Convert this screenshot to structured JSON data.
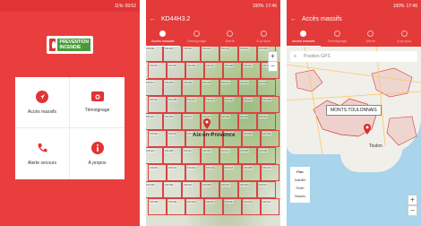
{
  "phone1": {
    "status_time": "09:52",
    "status_battery": "11%",
    "logo_line1": "PREVENTION",
    "logo_line2": "INCENDIE",
    "tiles": [
      {
        "label": "Accès massifs",
        "icon": "navigation-icon"
      },
      {
        "label": "Témoignage",
        "icon": "camera-icon"
      },
      {
        "label": "Alerte secours",
        "icon": "phone-icon"
      },
      {
        "label": "À propos",
        "icon": "info-icon"
      }
    ]
  },
  "phone2": {
    "status_time": "17:46",
    "status_battery": "100%",
    "title": "KD44H3.2",
    "tabs": [
      "Accès massifs",
      "Témoignage",
      "Alerte",
      "À propos"
    ],
    "map_city": "Aix-en-Provence",
    "zoom_in": "+",
    "zoom_out": "−",
    "tile_codes": [
      "KD44E",
      "KD44F",
      "KD44G",
      "KD44H",
      "KD44I",
      "KD43A",
      "KD43B",
      "KD43C",
      "KD43D",
      "KD43E",
      "KD42A",
      "KD42B",
      "KD42C",
      "KD42D",
      "KD41A",
      "KD41B"
    ]
  },
  "phone3": {
    "status_time": "17:46",
    "status_battery": "100%",
    "title": "Accès massifs",
    "tabs": [
      "Accès massifs",
      "Témoignage",
      "Alerte",
      "À propos"
    ],
    "search_placeholder": "Position GPS",
    "massif_label": "MONTS TOULONNAIS",
    "city": "Toulon",
    "legend": [
      "Plan",
      "Satellite",
      "Relief",
      "Massifs"
    ],
    "zoom_in": "+",
    "zoom_out": "−"
  },
  "colors": {
    "brand_red": "#e43a3a",
    "grid_red": "#d74444"
  }
}
